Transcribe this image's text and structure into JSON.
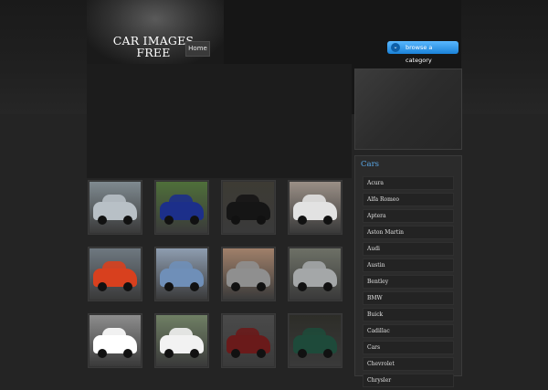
{
  "header": {
    "logo_line1": "CAR IMAGES",
    "logo_line2": "FREE",
    "nav_home": "Home",
    "browse_label": "browse a category"
  },
  "sidebar": {
    "title": "Cars",
    "categories": [
      "Acura",
      "Alfa Romeo",
      "Aptera",
      "Aston Martin",
      "Audi",
      "Austin",
      "Bentley",
      "BMW",
      "Buick",
      "Cadillac",
      "Cars",
      "Chevrolet",
      "Chrysler"
    ]
  },
  "gallery": {
    "thumbnails": [
      {
        "icon": "silver-bmw-sedan-photo",
        "bg": "#7f8a90",
        "car": "#b8c0c6"
      },
      {
        "icon": "blue-coupe-photo",
        "bg": "#4f6f3a",
        "car": "#1c2f8a"
      },
      {
        "icon": "black-sedan-photo",
        "bg": "#3d3b34",
        "car": "#151515"
      },
      {
        "icon": "white-wagon-photo",
        "bg": "#9a8f86",
        "car": "#e2e2e2"
      },
      {
        "icon": "red-mustang-photo",
        "bg": "#6e7880",
        "car": "#d8401e"
      },
      {
        "icon": "blue-classic-sedan-photo",
        "bg": "#8e9db0",
        "car": "#6f8fb8"
      },
      {
        "icon": "silver-pickup-photo",
        "bg": "#a0806a",
        "car": "#8f8f8f"
      },
      {
        "icon": "grey-minivan-photo",
        "bg": "#6d7066",
        "car": "#a4a7a8"
      },
      {
        "icon": "white-suv-photo",
        "bg": "#8d8d8d",
        "car": "#ffffff"
      },
      {
        "icon": "white-sports-car-photo",
        "bg": "#6f7f64",
        "car": "#f2f2f2"
      },
      {
        "icon": "dark-red-car-photo",
        "bg": "#4a4a4a",
        "car": "#6a1a1a"
      },
      {
        "icon": "green-sedan-photo",
        "bg": "#2d2d28",
        "car": "#1e4a3a"
      }
    ]
  }
}
